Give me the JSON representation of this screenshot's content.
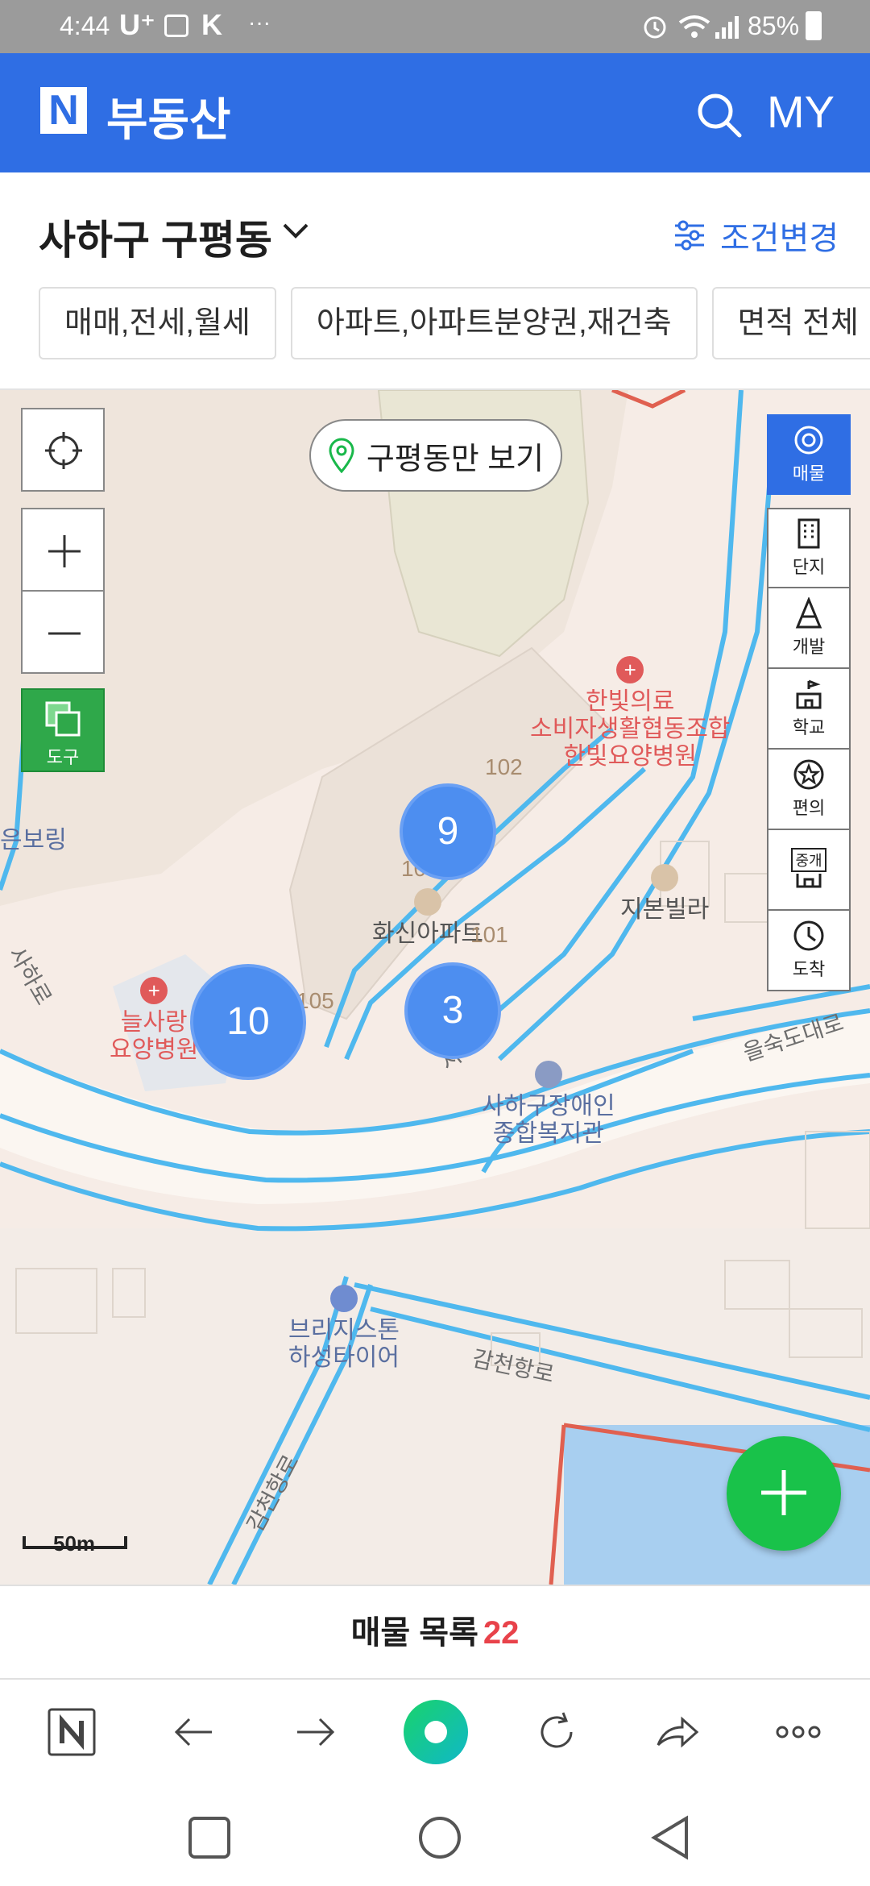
{
  "status_bar": {
    "time": "4:44",
    "carrier": "U⁺",
    "overflow": "···",
    "battery": "85%"
  },
  "header": {
    "logo": "N",
    "title": "부동산",
    "my_label": "MY"
  },
  "location": {
    "name": "사하구 구평동",
    "filter_label": "조건변경",
    "chips": [
      "매매,전세,월세",
      "아파트,아파트분양권,재건축",
      "면적 전체"
    ]
  },
  "map": {
    "only_dong_label": "구평동만 보기",
    "tool_label": "도구",
    "side_tools": [
      "매물",
      "단지",
      "개발",
      "학교",
      "편의",
      "도착"
    ],
    "agent_icon_text": "중개",
    "clusters": [
      {
        "id": "c9",
        "count": "9"
      },
      {
        "id": "c10",
        "count": "10"
      },
      {
        "id": "c3",
        "count": "3"
      }
    ],
    "labels": {
      "hospital_main": "한빛의료\n소비자생활협동조합\n한빛요양병원",
      "apt": "화신아파트",
      "villa": "지본빌라",
      "nursing": "늘사랑\n요양병원",
      "welfare": "사하구장애인\n종합복지관",
      "tire": "브리지스톤\n하성타이어",
      "boring": "은보링",
      "road1": "을숙도대로",
      "road2": "감천항로",
      "road3": "감천항로",
      "road4": "사하로",
      "road5": "사하로",
      "bldg102": "102",
      "bldg103": "103",
      "bldg101": "101",
      "bldg105": "105"
    },
    "scale": "50m"
  },
  "listing": {
    "label": "매물 목록",
    "count": "22"
  },
  "colors": {
    "brand_blue": "#2f6ee4",
    "fab_green": "#19c24a",
    "count_red": "#e8424a",
    "cluster_blue": "#4d8ef0",
    "road_blue": "#4fb8ee"
  }
}
